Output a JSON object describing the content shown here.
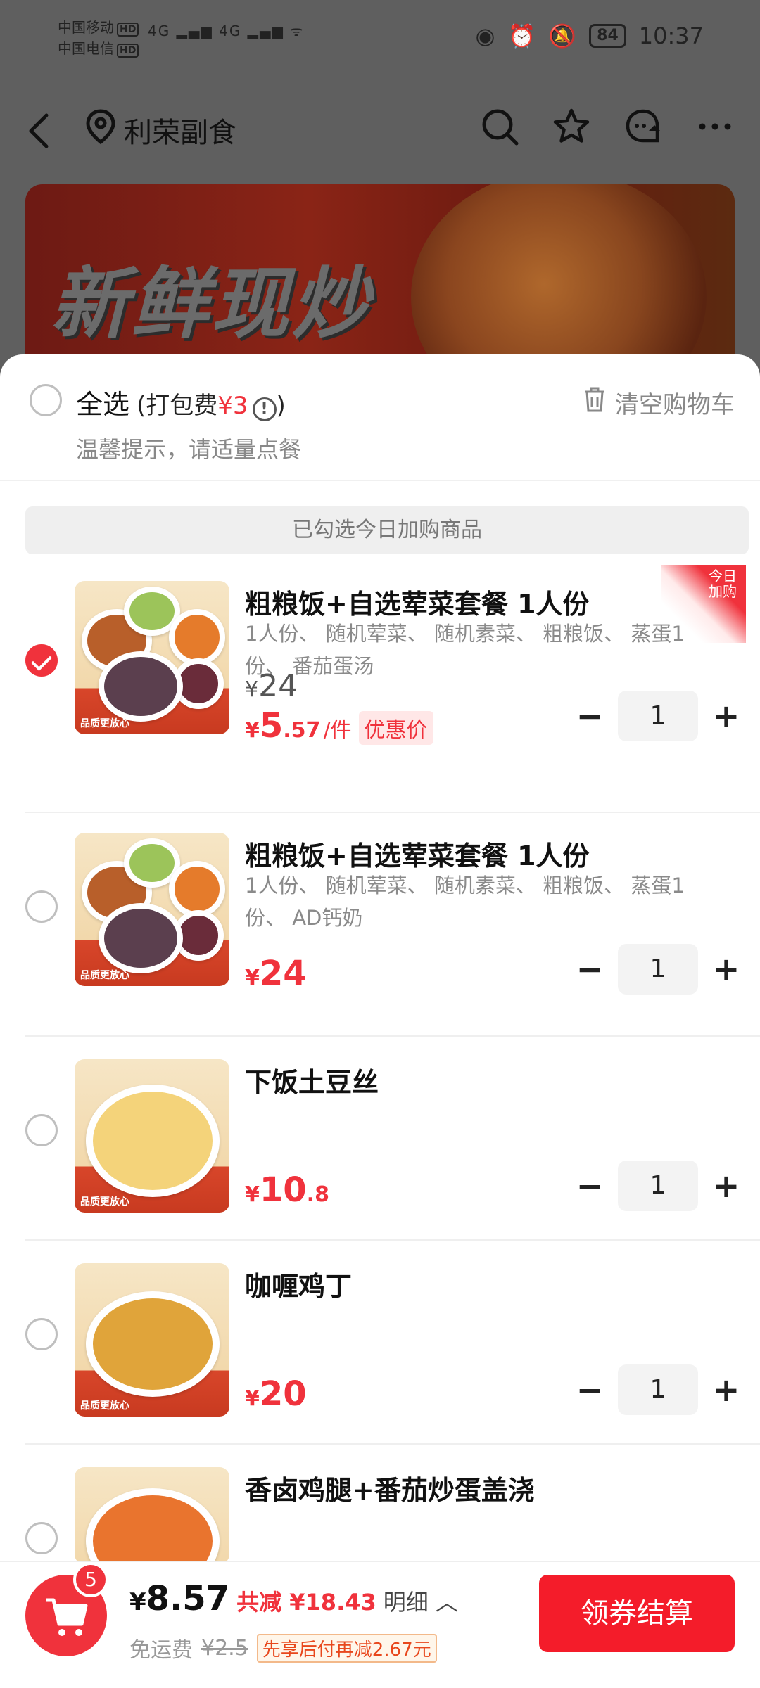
{
  "status_bar": {
    "carrier1": "中国移动",
    "carrier2": "中国电信",
    "hd": "HD",
    "net": "4G",
    "battery": "84",
    "time": "10:37"
  },
  "header": {
    "store_name": "利荣副食",
    "icons": [
      "back-icon",
      "location-pin-icon",
      "search-icon",
      "star-icon",
      "customer-service-icon",
      "more-icon"
    ]
  },
  "banner": {
    "text": "新鲜现炒"
  },
  "cart_sheet": {
    "select_all_label": "全选",
    "packing_fee_prefix": "(打包费",
    "packing_fee_value": "¥3",
    "packing_fee_suffix": ")",
    "clear_cart_label": "清空购物车",
    "tip": "温馨提示，请适量点餐",
    "section_title": "已勾选今日加购商品"
  },
  "items": [
    {
      "name": "粗粮饭+自选荤菜套餐 1人份",
      "desc": "1人份、 随机荤菜、 随机素菜、 粗粮饭、 蒸蛋1份、 番茄蛋汤",
      "checked": true,
      "corner_tag": "今日加购",
      "old_price_yen": "¥",
      "old_price": "24",
      "price_yen": "¥",
      "price_int": "5",
      "price_dec": ".57",
      "unit": "/件",
      "promo": "优惠价",
      "qty": "1"
    },
    {
      "name": "粗粮饭+自选荤菜套餐 1人份",
      "desc": "1人份、 随机荤菜、 随机素菜、 粗粮饭、 蒸蛋1份、 AD钙奶",
      "checked": false,
      "price_yen": "¥",
      "price_int": "24",
      "price_dec": "",
      "qty": "1"
    },
    {
      "name": "下饭土豆丝",
      "desc": "",
      "checked": false,
      "price_yen": "¥",
      "price_int": "10",
      "price_dec": ".8",
      "qty": "1"
    },
    {
      "name": "咖喱鸡丁",
      "desc": "",
      "checked": false,
      "price_yen": "¥",
      "price_int": "20",
      "price_dec": "",
      "qty": "1"
    },
    {
      "name": "香卤鸡腿+番茄炒蛋盖浇",
      "desc": "",
      "checked": false
    }
  ],
  "bottom_bar": {
    "cart_count": "5",
    "total_yen": "¥",
    "total": "8.57",
    "discount_label": "共减",
    "discount_value": "¥18.43",
    "detail_label": "明细",
    "delivery_label": "免运费",
    "delivery_old": "¥2.5",
    "pay_later": "先享后付再减2.67元",
    "checkout_label": "领券结算"
  },
  "colors": {
    "accent": "#f0323c",
    "checkout": "#f41c2a"
  }
}
